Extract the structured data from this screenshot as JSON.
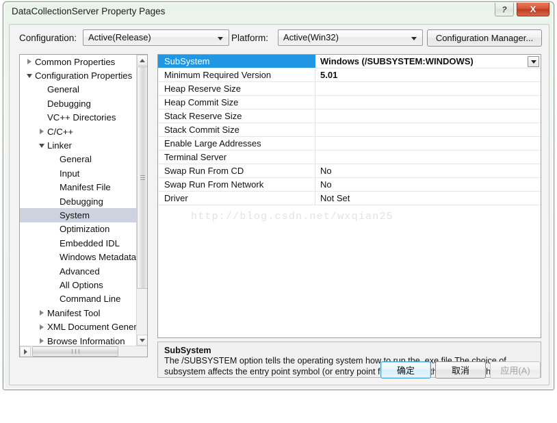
{
  "window": {
    "title": "DataCollectionServer Property Pages",
    "help_label": "?",
    "close_label": "X"
  },
  "toolbar": {
    "configuration_label": "Configuration:",
    "configuration_value": "Active(Release)",
    "platform_label": "Platform:",
    "platform_value": "Active(Win32)",
    "configuration_manager_label": "Configuration Manager..."
  },
  "tree": {
    "nodes": [
      {
        "label": "Common Properties",
        "indent": 0,
        "state": "collapsed",
        "selected": false
      },
      {
        "label": "Configuration Properties",
        "indent": 0,
        "state": "expanded",
        "selected": false
      },
      {
        "label": "General",
        "indent": 1,
        "state": "leaf",
        "selected": false
      },
      {
        "label": "Debugging",
        "indent": 1,
        "state": "leaf",
        "selected": false
      },
      {
        "label": "VC++ Directories",
        "indent": 1,
        "state": "leaf",
        "selected": false
      },
      {
        "label": "C/C++",
        "indent": 1,
        "state": "collapsed",
        "selected": false
      },
      {
        "label": "Linker",
        "indent": 1,
        "state": "expanded",
        "selected": false
      },
      {
        "label": "General",
        "indent": 2,
        "state": "leaf",
        "selected": false
      },
      {
        "label": "Input",
        "indent": 2,
        "state": "leaf",
        "selected": false
      },
      {
        "label": "Manifest File",
        "indent": 2,
        "state": "leaf",
        "selected": false
      },
      {
        "label": "Debugging",
        "indent": 2,
        "state": "leaf",
        "selected": false
      },
      {
        "label": "System",
        "indent": 2,
        "state": "leaf",
        "selected": true
      },
      {
        "label": "Optimization",
        "indent": 2,
        "state": "leaf",
        "selected": false
      },
      {
        "label": "Embedded IDL",
        "indent": 2,
        "state": "leaf",
        "selected": false
      },
      {
        "label": "Windows Metadata",
        "indent": 2,
        "state": "leaf",
        "selected": false
      },
      {
        "label": "Advanced",
        "indent": 2,
        "state": "leaf",
        "selected": false
      },
      {
        "label": "All Options",
        "indent": 2,
        "state": "leaf",
        "selected": false
      },
      {
        "label": "Command Line",
        "indent": 2,
        "state": "leaf",
        "selected": false
      },
      {
        "label": "Manifest Tool",
        "indent": 1,
        "state": "collapsed",
        "selected": false
      },
      {
        "label": "XML Document Generator",
        "indent": 1,
        "state": "collapsed",
        "selected": false
      },
      {
        "label": "Browse Information",
        "indent": 1,
        "state": "collapsed",
        "selected": false
      }
    ]
  },
  "grid": {
    "rows": [
      {
        "name": "SubSystem",
        "value": "Windows (/SUBSYSTEM:WINDOWS)",
        "selected": true,
        "bold": true
      },
      {
        "name": "Minimum Required Version",
        "value": "5.01",
        "selected": false,
        "bold": true
      },
      {
        "name": "Heap Reserve Size",
        "value": "",
        "selected": false,
        "bold": false
      },
      {
        "name": "Heap Commit Size",
        "value": "",
        "selected": false,
        "bold": false
      },
      {
        "name": "Stack Reserve Size",
        "value": "",
        "selected": false,
        "bold": false
      },
      {
        "name": "Stack Commit Size",
        "value": "",
        "selected": false,
        "bold": false
      },
      {
        "name": "Enable Large Addresses",
        "value": "",
        "selected": false,
        "bold": false
      },
      {
        "name": "Terminal Server",
        "value": "",
        "selected": false,
        "bold": false
      },
      {
        "name": "Swap Run From CD",
        "value": "No",
        "selected": false,
        "bold": false
      },
      {
        "name": "Swap Run From Network",
        "value": "No",
        "selected": false,
        "bold": false
      },
      {
        "name": "Driver",
        "value": "Not Set",
        "selected": false,
        "bold": false
      }
    ],
    "watermark": "http://blog.csdn.net/wxqian25"
  },
  "description": {
    "title": "SubSystem",
    "body": "The /SUBSYSTEM option tells the operating system how to run the .exe file.The choice of subsystem affects the entry point symbol (or entry point function) that the linker will choose."
  },
  "buttons": {
    "ok": "确定",
    "cancel": "取消",
    "apply": "应用(A)"
  },
  "colors": {
    "selection_blue": "#2196e3",
    "tree_selection": "#cdd3de",
    "close_red": "#bf3b20"
  }
}
